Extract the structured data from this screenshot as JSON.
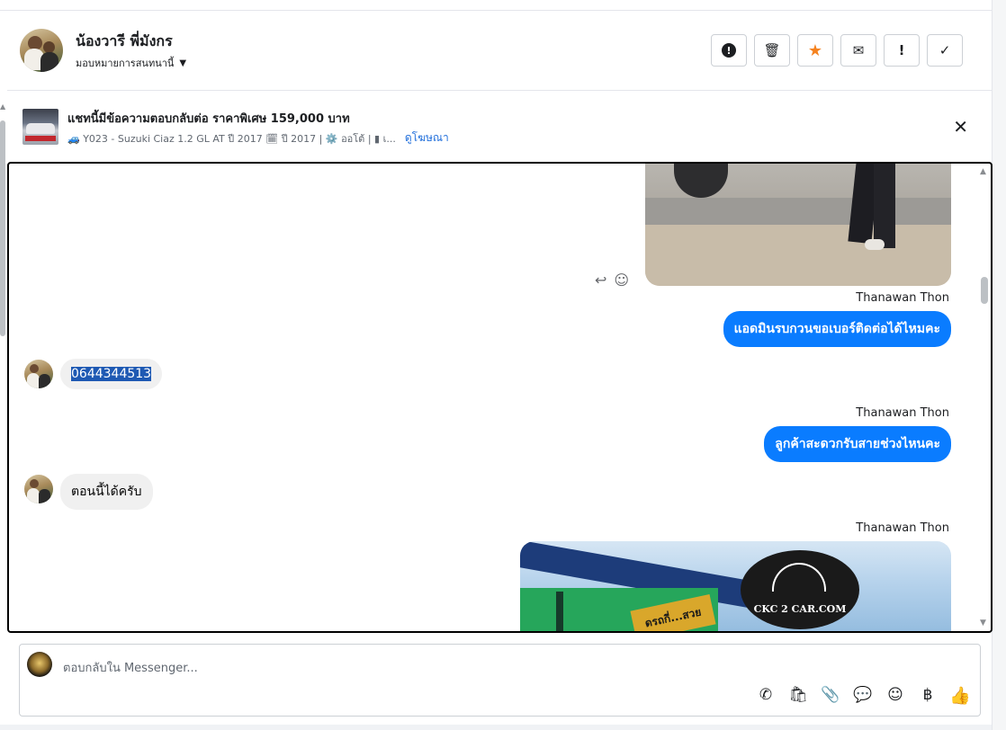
{
  "header": {
    "contact_name": "น้องวารี พี่มังกร",
    "assign_label": "มอบหมายการสนทนานี้",
    "actions": [
      {
        "name": "report-icon",
        "symbol": "!"
      },
      {
        "name": "trash-icon",
        "symbol": "🗑"
      },
      {
        "name": "star-icon",
        "symbol": "★"
      },
      {
        "name": "envelope-icon",
        "symbol": "✉"
      },
      {
        "name": "exclamation-icon",
        "symbol": "!"
      },
      {
        "name": "check-icon",
        "symbol": "✓"
      }
    ],
    "accent_star": "#f5821f"
  },
  "ad": {
    "title": "แชทนี้มีข้อความตอบกลับต่อ ราคาพิเศษ 159,000 บาท",
    "subtitle": "🚙 Y023 - Suzuki Ciaz 1.2 GL AT ปี 2017 🗓 ปี 2017 | ⚙️ ออโต้ | ▮ เ...",
    "link": "ดูโฆษณา",
    "close_symbol": "✕"
  },
  "messages": {
    "reaction_reply": "↩",
    "reaction_emoji": "☺",
    "sender_1": "Thanawan Thon",
    "out_1": "แอดมินรบกวนขอเบอร์ติดต่อได้ไหมคะ",
    "in_1": "0644344513",
    "sender_2": "Thanawan Thon",
    "out_2": "ลูกค้าสะดวกรับสายช่วงไหนคะ",
    "in_2": "ตอนนี้ได้ครับ",
    "sender_3": "Thanawan Thon",
    "image_logo_text": "CKC 2 CAR.COM",
    "image_sign_text": "ดรถกี่...สวย",
    "bubble_out_color": "#0a7cff",
    "bubble_in_color": "#f0f0f0"
  },
  "composer": {
    "placeholder": "ตอบกลับใน Messenger...",
    "tools": [
      {
        "name": "phone-add-icon",
        "symbol": "✆"
      },
      {
        "name": "shopping-bag-icon",
        "symbol": "🛍"
      },
      {
        "name": "paperclip-icon",
        "symbol": "📎"
      },
      {
        "name": "saved-reply-icon",
        "symbol": "💬"
      },
      {
        "name": "emoji-icon",
        "symbol": "☺"
      },
      {
        "name": "baht-icon",
        "symbol": "฿"
      },
      {
        "name": "thumbs-up-icon",
        "symbol": "👍"
      }
    ]
  }
}
